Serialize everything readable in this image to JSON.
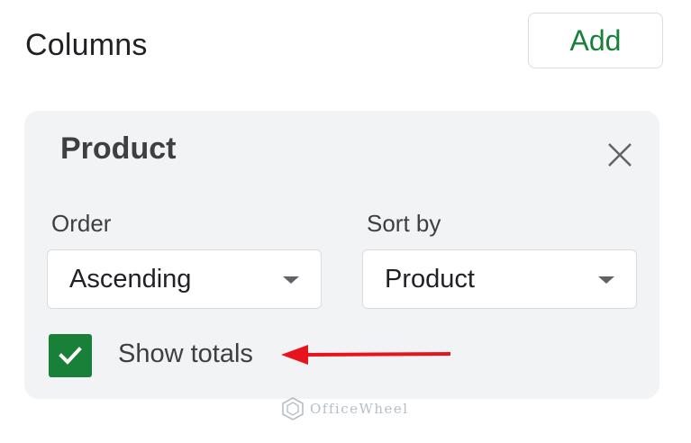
{
  "columns_section": {
    "title": "Columns",
    "add_label": "Add"
  },
  "column_card": {
    "title": "Product",
    "order": {
      "label": "Order",
      "value": "Ascending"
    },
    "sort_by": {
      "label": "Sort by",
      "value": "Product"
    },
    "show_totals": {
      "label": "Show totals",
      "checked": true
    }
  },
  "annotation": {
    "arrow_color": "#e8141b"
  },
  "watermark": {
    "text": "OfficeWheel"
  },
  "colors": {
    "accent_green": "#188038",
    "card_background": "#f1f3f4"
  },
  "icons": {
    "close": "close-icon",
    "dropdown": "chevron-down-icon",
    "check": "check-icon"
  }
}
